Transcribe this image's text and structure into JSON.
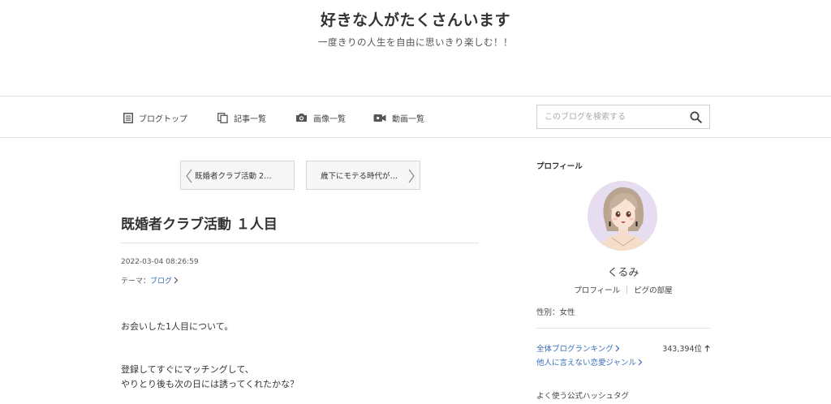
{
  "header": {
    "site_title": "好きな人がたくさんいます",
    "site_subtitle": "一度きりの人生を自由に思いきり楽しむ！！"
  },
  "nav": {
    "items": [
      {
        "label": "ブログトップ",
        "icon": "document-icon"
      },
      {
        "label": "記事一覧",
        "icon": "copy-icon"
      },
      {
        "label": "画像一覧",
        "icon": "camera-icon"
      },
      {
        "label": "動画一覧",
        "icon": "video-icon"
      }
    ],
    "search_placeholder": "このブログを検索する",
    "search_value": ""
  },
  "pager": {
    "prev_label": "既婚者クラブ活動 2…",
    "next_label": "歳下にモテる時代が…"
  },
  "entry": {
    "title": "既婚者クラブ活動 １人目",
    "date": "2022-03-04 08:26:59",
    "theme_prefix": "テーマ：",
    "theme": "ブログ",
    "paragraphs": [
      "お会いした1人目について。",
      "登録してすぐにマッチングして、",
      "やりとり後も次の日には誘ってくれたかな？"
    ]
  },
  "sidebar": {
    "heading": "プロフィール",
    "nickname": "くるみ",
    "profile_link": "プロフィール",
    "pig_room_link": "ピグの部屋",
    "gender": "性別：女性",
    "ranking_overall": "全体ブログランキング",
    "ranking_value": "343,394位",
    "ranking_genre": "他人に言えない恋愛ジャンル",
    "hashtag_heading": "よく使う公式ハッシュタグ"
  },
  "colors": {
    "link": "#3a6eb5",
    "avatar_bg": "#e6ddf0",
    "border": "#e3e3e3"
  }
}
